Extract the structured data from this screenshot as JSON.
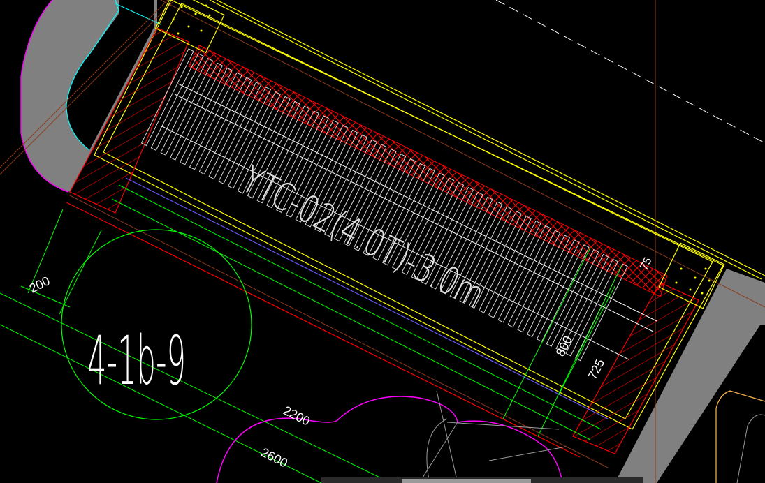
{
  "drawing": {
    "main_label": "YTC-02(4.0T)-3.0m",
    "zone_label": "4-1b-9",
    "dims": {
      "d200": "200",
      "d2200": "2200",
      "d2600": "2600",
      "d800": "800",
      "d725": "725",
      "d75": "75"
    }
  },
  "colors": {
    "background": "#000000",
    "outline_yellow": "#ffff00",
    "hatch_red": "#ff0000",
    "dim_green": "#00ff00",
    "arc_magenta": "#ff00ff",
    "fill_gray": "#808080",
    "line_white": "#ffffff",
    "line_cyan": "#00ffff",
    "line_blue": "#6a5aff",
    "line_brown": "#8b3a1a"
  }
}
